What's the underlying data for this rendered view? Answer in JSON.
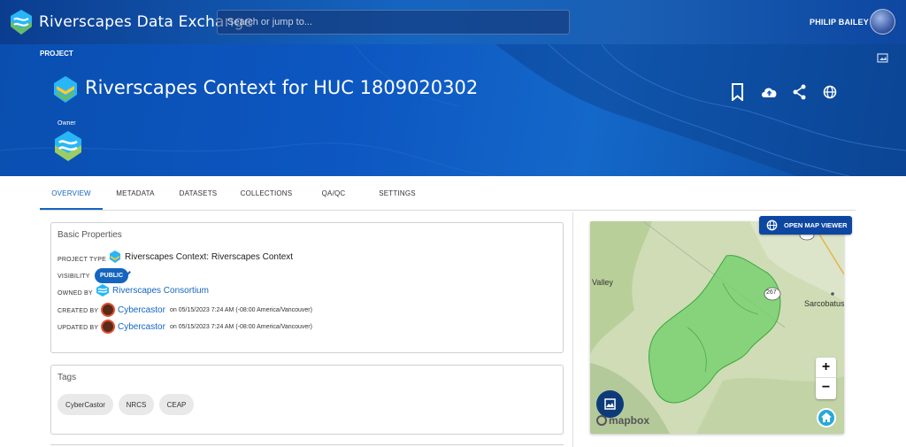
{
  "app": {
    "brand": "Riverscapes Data Exchange"
  },
  "search": {
    "placeholder": "Search or jump to..."
  },
  "user": {
    "name": "PHILIP BAILEY"
  },
  "project": {
    "section_label": "PROJECT",
    "title": "Riverscapes Context for HUC 1809020302",
    "owner_label": "Owner"
  },
  "hero_actions": [
    "bookmark-icon",
    "cloud-upload-icon",
    "share-icon",
    "globe-icon"
  ],
  "tabs": [
    {
      "label": "OVERVIEW",
      "active": true
    },
    {
      "label": "METADATA"
    },
    {
      "label": "DATASETS"
    },
    {
      "label": "COLLECTIONS"
    },
    {
      "label": "QA/QC"
    },
    {
      "label": "SETTINGS"
    }
  ],
  "basic": {
    "title": "Basic Properties",
    "project_type_label": "PROJECT TYPE",
    "project_type": "Riverscapes Context: Riverscapes Context",
    "visibility_label": "VISIBILITY",
    "visibility": "PUBLIC",
    "owned_by_label": "OWNED BY",
    "owned_by": "Riverscapes Consortium",
    "created_by_label": "CREATED BY",
    "created_by": "Cybercastor",
    "created_on": "on 05/15/2023 7:24 AM (-08:00 America/Vancouver)",
    "updated_by_label": "UPDATED BY",
    "updated_by": "Cybercastor",
    "updated_on": "on 05/15/2023 7:24 AM (-08:00 America/Vancouver)"
  },
  "tags": {
    "title": "Tags",
    "items": [
      "CyberCastor",
      "NRCS",
      "CEAP"
    ]
  },
  "map": {
    "open_button": "OPEN MAP VIEWER",
    "labels": {
      "valley": "Valley",
      "route": "267",
      "town": "Sarcobatus"
    },
    "zoom_in": "+",
    "zoom_out": "−",
    "attribution": "mapbox"
  },
  "colors": {
    "primary": "#1565c0",
    "hero": "#0d57c2",
    "polygon": "#6fd06a"
  }
}
